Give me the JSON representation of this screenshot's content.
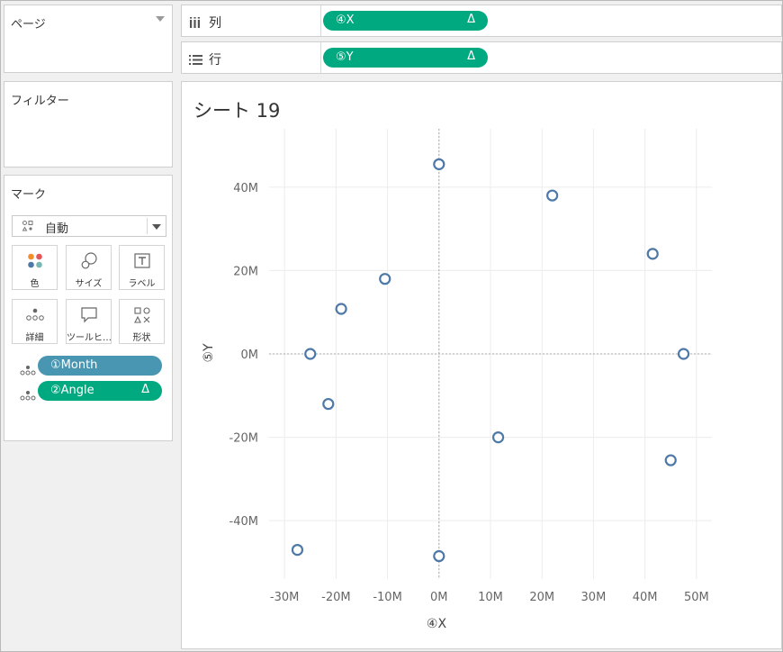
{
  "pages": {
    "title": "ページ"
  },
  "filters": {
    "title": "フィルター"
  },
  "marks": {
    "title": "マーク",
    "type_dropdown": "自動",
    "buttons": [
      {
        "label": "色",
        "icon": "color-icon"
      },
      {
        "label": "サイズ",
        "icon": "size-icon"
      },
      {
        "label": "ラベル",
        "icon": "label-icon"
      },
      {
        "label": "詳細",
        "icon": "detail-icon"
      },
      {
        "label": "ツールヒ…",
        "icon": "tooltip-icon"
      },
      {
        "label": "形状",
        "icon": "shape-icon"
      }
    ],
    "fields": [
      {
        "label": "①Month",
        "color": "#4996b2"
      },
      {
        "label": "②Angle",
        "delta": "Δ",
        "color": "#00a97f"
      }
    ]
  },
  "shelves": {
    "columns": {
      "label": "列",
      "pill": "④X",
      "delta": "Δ"
    },
    "rows": {
      "label": "行",
      "pill": "⑤Y",
      "delta": "Δ"
    }
  },
  "sheet": {
    "title": "シート 19"
  },
  "colors": {
    "mark": "#4e79a7",
    "dimension_pill": "#4996b2",
    "measure_pill": "#00a97f"
  },
  "chart_data": {
    "type": "scatter",
    "xlabel": "④X",
    "ylabel": "⑤Y",
    "xlim": [
      -33,
      53
    ],
    "ylim": [
      -54,
      54
    ],
    "x_ticks": [
      -30,
      -20,
      -10,
      0,
      10,
      20,
      30,
      40,
      50
    ],
    "x_tick_labels": [
      "-30M",
      "-20M",
      "-10M",
      "0M",
      "10M",
      "20M",
      "30M",
      "40M",
      "50M"
    ],
    "y_ticks": [
      40,
      20,
      0,
      -20,
      -40
    ],
    "y_tick_labels": [
      "40M",
      "20M",
      "0M",
      "-20M",
      "-40M"
    ],
    "points": [
      {
        "x": 0,
        "y": 45.5
      },
      {
        "x": 22,
        "y": 38
      },
      {
        "x": 41.5,
        "y": 24
      },
      {
        "x": 47.5,
        "y": 0
      },
      {
        "x": -10.5,
        "y": 18
      },
      {
        "x": -19,
        "y": 10.8
      },
      {
        "x": -25,
        "y": 0
      },
      {
        "x": -21.5,
        "y": -12
      },
      {
        "x": 11.5,
        "y": -20
      },
      {
        "x": 45,
        "y": -25.5
      },
      {
        "x": -27.5,
        "y": -47
      },
      {
        "x": 0,
        "y": -48.5
      }
    ]
  }
}
